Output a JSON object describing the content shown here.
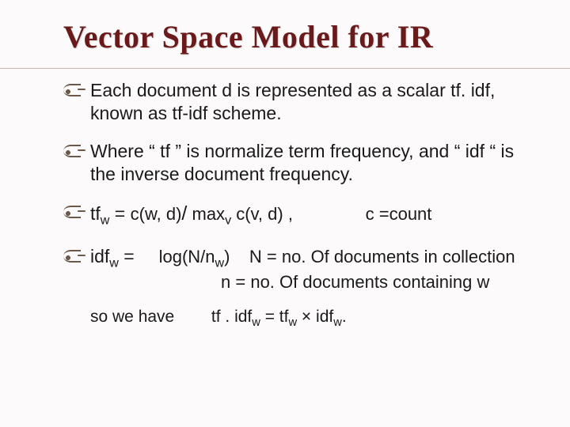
{
  "title": "Vector Space Model for IR",
  "bullets": {
    "b1": "Each document d is represented as a scalar tf. idf, known as tf-idf scheme.",
    "b2": "Where “ tf ” is normalize term frequency, and “ idf “ is the inverse document frequency.",
    "b3_lhs": "tf",
    "b3_lhs_sub": "w",
    "b3_eq": "   =  ",
    "b3_rhs_a": "c(w, d)",
    "b3_slash": "/",
    "b3_rhs_b": " max",
    "b3_rhs_b_sub": "v",
    "b3_rhs_c": " c(v, d) ,",
    "b3_tail": "               c =count",
    "b4_lhs": "idf",
    "b4_lhs_sub": "w",
    "b4_eq": "  = ",
    "b4_log_a": "    log(N/n",
    "b4_log_sub": "w",
    "b4_log_b": ")",
    "b4_def1": "    N = no. Of documents in collection",
    "b4_def2b_a": "                           n = no. Of documents containing w"
  },
  "closing": {
    "lead": "so we have",
    "eq_a": "        tf . idf",
    "eq_sub1": "w",
    "eq_b": " = tf",
    "eq_sub2": "w",
    "eq_c": " × idf",
    "eq_sub3": "w",
    "eq_d": "."
  }
}
